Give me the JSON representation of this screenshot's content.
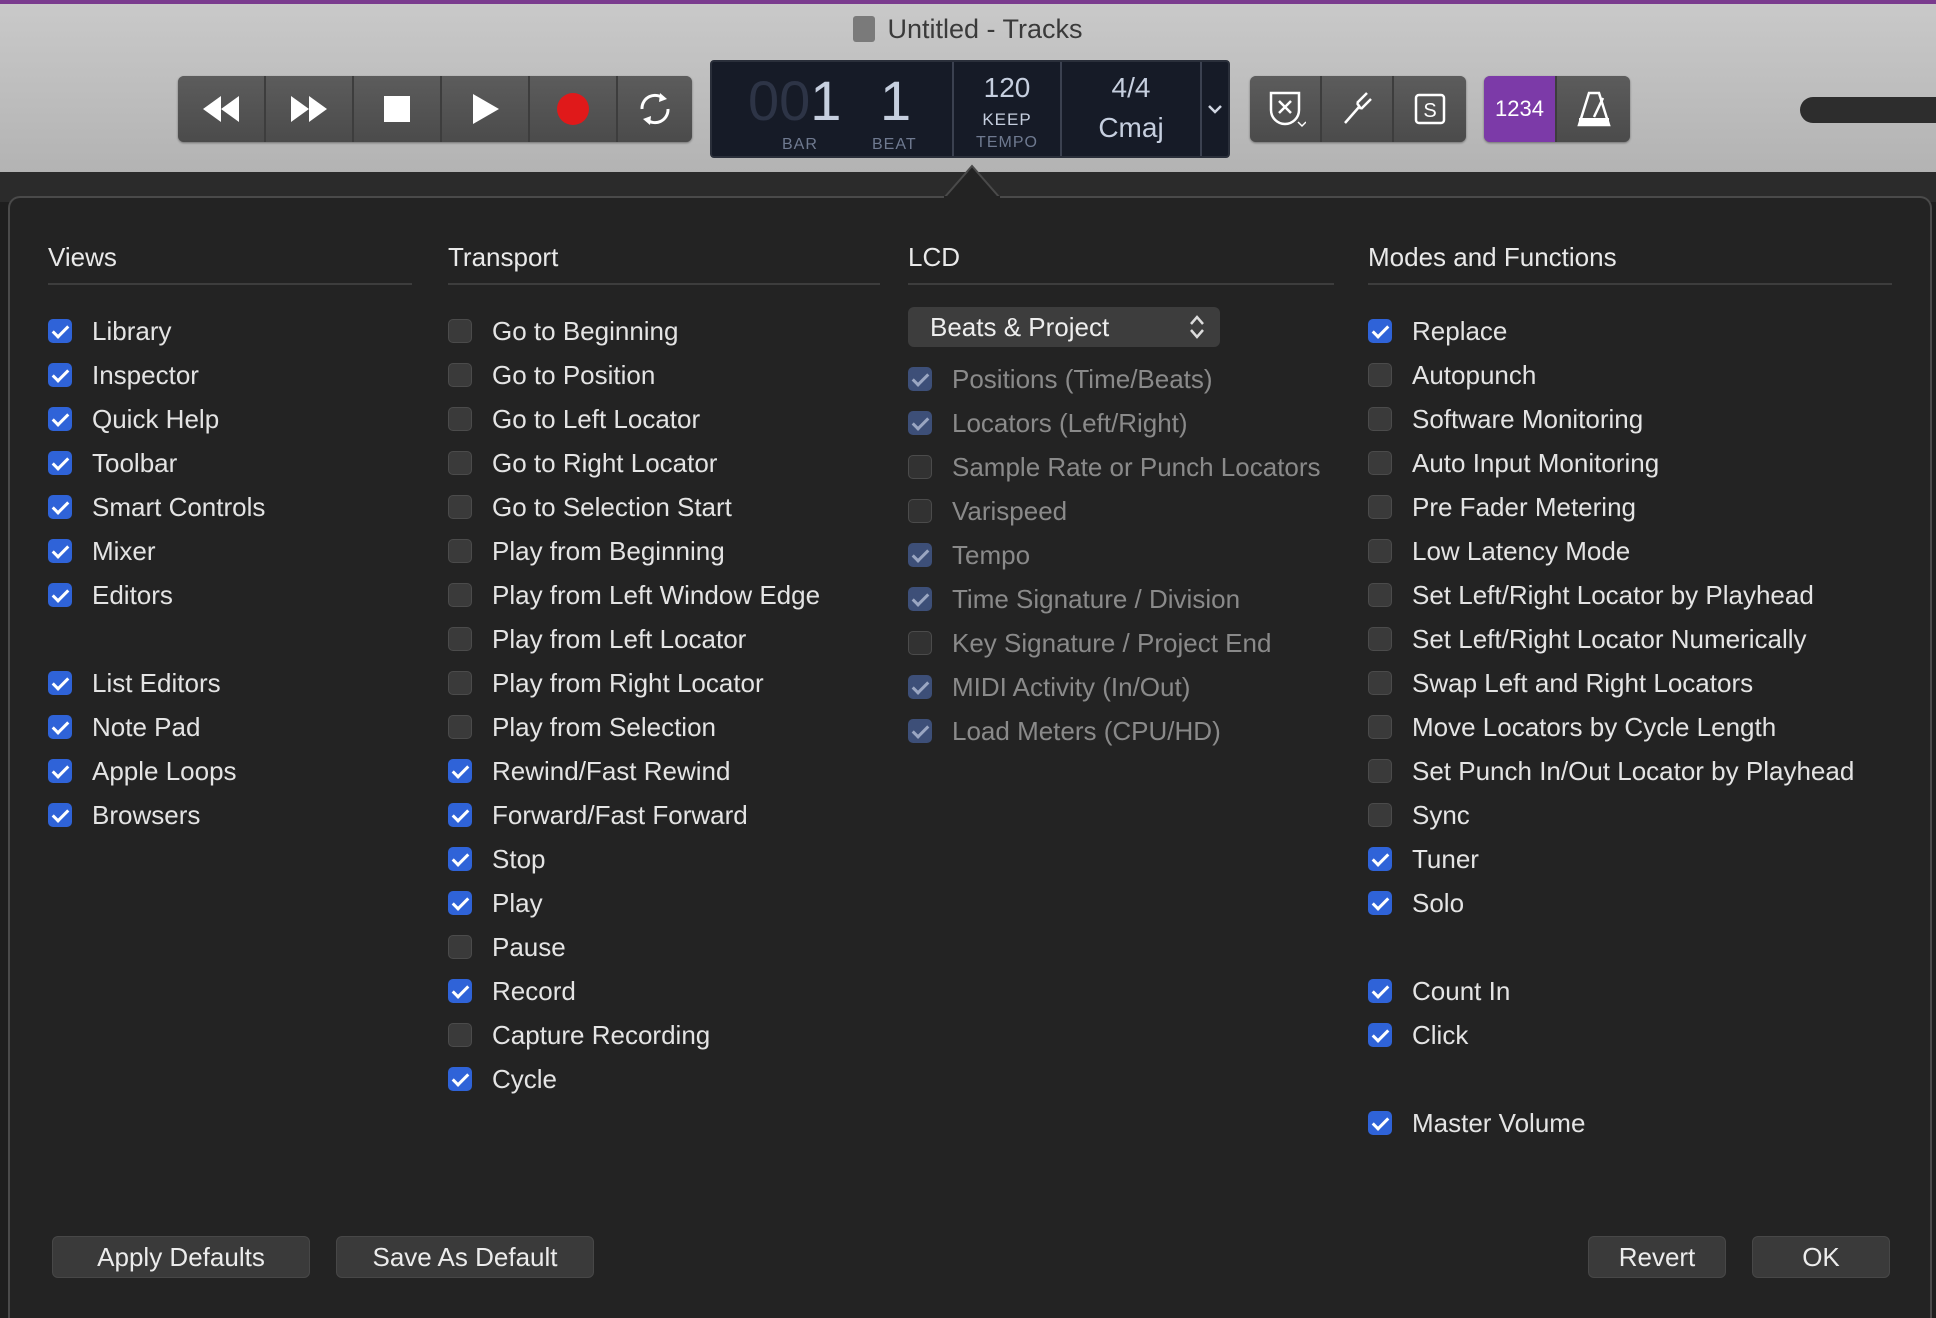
{
  "window": {
    "title": "Untitled - Tracks"
  },
  "toolbar": {
    "transport": [
      {
        "name": "rewind-icon"
      },
      {
        "name": "fast-forward-icon"
      },
      {
        "name": "stop-icon"
      },
      {
        "name": "play-icon"
      },
      {
        "name": "record-icon"
      },
      {
        "name": "cycle-icon"
      }
    ],
    "lcd": {
      "bar_dim": "00",
      "bar": "1",
      "beat": "1",
      "bar_label": "BAR",
      "beat_label": "BEAT",
      "tempo": "120",
      "tempo_mode": "KEEP",
      "tempo_label": "TEMPO",
      "time_signature": "4/4",
      "key": "Cmaj"
    },
    "modes_number": "1234",
    "accent_color": "#7c3aa8"
  },
  "popover": {
    "views": {
      "title": "Views",
      "items": [
        {
          "label": "Library",
          "checked": true
        },
        {
          "label": "Inspector",
          "checked": true
        },
        {
          "label": "Quick Help",
          "checked": true
        },
        {
          "label": "Toolbar",
          "checked": true
        },
        {
          "label": "Smart Controls",
          "checked": true
        },
        {
          "label": "Mixer",
          "checked": true
        },
        {
          "label": "Editors",
          "checked": true
        },
        {
          "label": "List Editors",
          "checked": true,
          "gap": true
        },
        {
          "label": "Note Pad",
          "checked": true
        },
        {
          "label": "Apple Loops",
          "checked": true
        },
        {
          "label": "Browsers",
          "checked": true
        }
      ]
    },
    "transport": {
      "title": "Transport",
      "items": [
        {
          "label": "Go to Beginning",
          "checked": false
        },
        {
          "label": "Go to Position",
          "checked": false
        },
        {
          "label": "Go to Left Locator",
          "checked": false
        },
        {
          "label": "Go to Right Locator",
          "checked": false
        },
        {
          "label": "Go to Selection Start",
          "checked": false
        },
        {
          "label": "Play from Beginning",
          "checked": false
        },
        {
          "label": "Play from Left Window Edge",
          "checked": false
        },
        {
          "label": "Play from Left Locator",
          "checked": false
        },
        {
          "label": "Play from Right Locator",
          "checked": false
        },
        {
          "label": "Play from Selection",
          "checked": false
        },
        {
          "label": "Rewind/Fast Rewind",
          "checked": true
        },
        {
          "label": "Forward/Fast Forward",
          "checked": true
        },
        {
          "label": "Stop",
          "checked": true
        },
        {
          "label": "Play",
          "checked": true
        },
        {
          "label": "Pause",
          "checked": false
        },
        {
          "label": "Record",
          "checked": true
        },
        {
          "label": "Capture Recording",
          "checked": false
        },
        {
          "label": "Cycle",
          "checked": true
        }
      ]
    },
    "lcd": {
      "title": "LCD",
      "select_value": "Beats & Project",
      "items": [
        {
          "label": "Positions (Time/Beats)",
          "checked": true
        },
        {
          "label": "Locators (Left/Right)",
          "checked": true
        },
        {
          "label": "Sample Rate or Punch Locators",
          "checked": false
        },
        {
          "label": "Varispeed",
          "checked": false
        },
        {
          "label": "Tempo",
          "checked": true
        },
        {
          "label": "Time Signature / Division",
          "checked": true
        },
        {
          "label": "Key Signature / Project End",
          "checked": false
        },
        {
          "label": "MIDI Activity (In/Out)",
          "checked": true
        },
        {
          "label": "Load Meters (CPU/HD)",
          "checked": true
        }
      ]
    },
    "modes": {
      "title": "Modes and Functions",
      "items": [
        {
          "label": "Replace",
          "checked": true
        },
        {
          "label": "Autopunch",
          "checked": false
        },
        {
          "label": "Software Monitoring",
          "checked": false
        },
        {
          "label": "Auto Input Monitoring",
          "checked": false
        },
        {
          "label": "Pre Fader Metering",
          "checked": false
        },
        {
          "label": "Low Latency Mode",
          "checked": false
        },
        {
          "label": "Set Left/Right Locator by Playhead",
          "checked": false
        },
        {
          "label": "Set Left/Right Locator Numerically",
          "checked": false
        },
        {
          "label": "Swap Left and Right Locators",
          "checked": false
        },
        {
          "label": "Move Locators by Cycle Length",
          "checked": false
        },
        {
          "label": "Set Punch In/Out Locator by Playhead",
          "checked": false
        },
        {
          "label": "Sync",
          "checked": false
        },
        {
          "label": "Tuner",
          "checked": true
        },
        {
          "label": "Solo",
          "checked": true
        },
        {
          "label": "Count In",
          "checked": true,
          "gap": true
        },
        {
          "label": "Click",
          "checked": true
        },
        {
          "label": "Master Volume",
          "checked": true,
          "gap": true
        }
      ]
    },
    "buttons": {
      "apply_defaults": "Apply Defaults",
      "save_as_default": "Save As Default",
      "revert": "Revert",
      "ok": "OK"
    },
    "checkbox_color": "#2f63d8"
  }
}
